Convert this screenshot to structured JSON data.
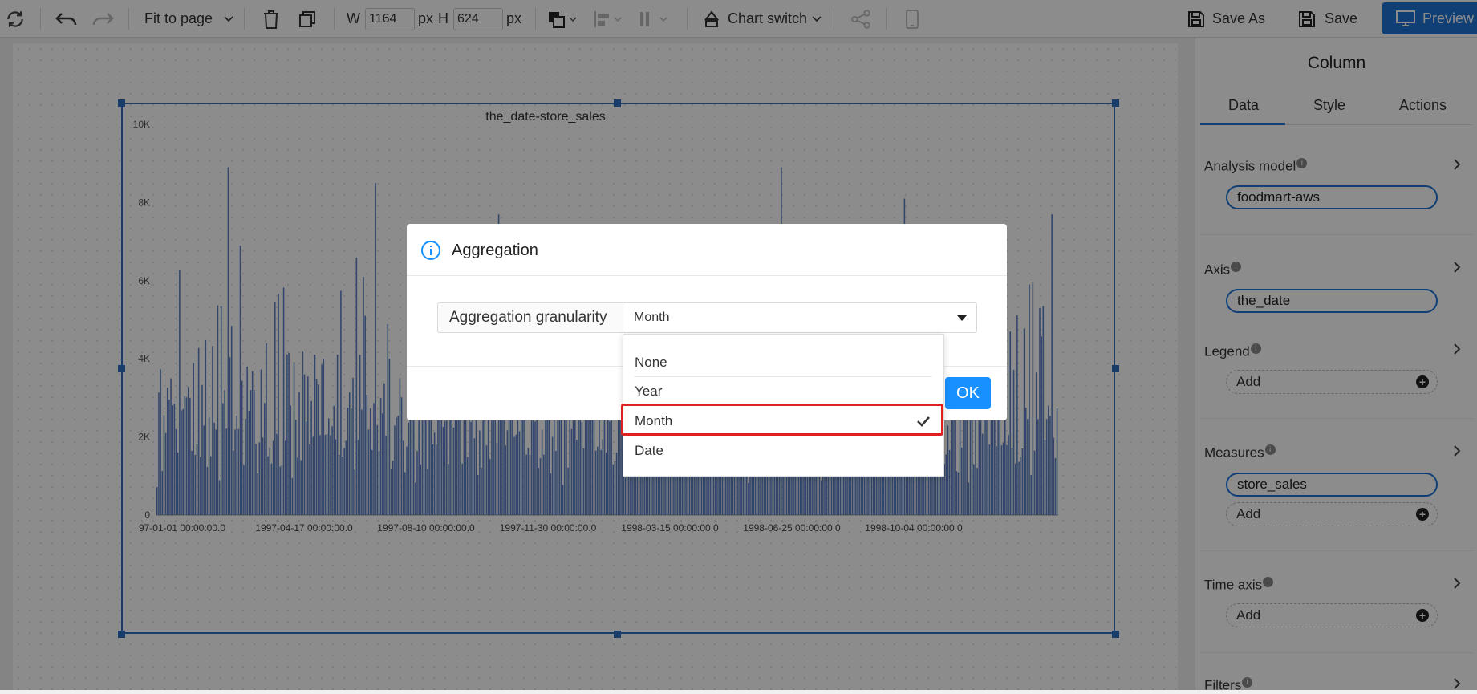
{
  "toolbar": {
    "fit_label": "Fit to page",
    "w_label": "W",
    "w_value": "1164",
    "px1": "px",
    "h_label": "H",
    "h_value": "624",
    "px2": "px",
    "chart_switch_label": "Chart switch",
    "save_as_label": "Save As",
    "save_label": "Save",
    "preview_label": "Preview"
  },
  "panel": {
    "title": "Column",
    "tabs": [
      "Data",
      "Style",
      "Actions"
    ],
    "analysis_model_label": "Analysis model",
    "analysis_model_value": "foodmart-aws",
    "axis_label": "Axis",
    "axis_value": "the_date",
    "legend_label": "Legend",
    "measures_label": "Measures",
    "measures_value": "store_sales",
    "time_axis_label": "Time axis",
    "filters_label": "Filters",
    "add_label": "Add",
    "info_glyph": "i"
  },
  "dialog": {
    "title": "Aggregation",
    "field_label": "Aggregation granularity",
    "selected_value": "Month",
    "ok_label": "OK",
    "options": [
      "None",
      "Year",
      "Month",
      "Date"
    ]
  },
  "chart_data": {
    "type": "bar",
    "title": "the_date-store_sales",
    "ylim": [
      0,
      10000
    ],
    "y_ticks": [
      "0",
      "2K",
      "4K",
      "6K",
      "8K",
      "10K"
    ],
    "x_tick_labels": [
      "97-01-01 00:00:00.0",
      "1997-04-17 00:00:00.0",
      "1997-08-10 00:00:00.0",
      "1997-11-30 00:00:00.0",
      "1998-03-15 00:00:00.0",
      "1998-06-25 00:00:00.0",
      "1998-10-04 00:00:00.0"
    ],
    "bar_color": "#5b7fc4",
    "approx_daily_values_sample": [
      1300,
      2200,
      2000,
      5600,
      1500,
      2800,
      3500,
      4300,
      2000,
      1800,
      3000,
      6900,
      2500,
      3200,
      4100,
      7100,
      2400,
      3800,
      3000,
      2200,
      4700,
      3300,
      1900,
      2600,
      3900,
      2800,
      5000,
      2500,
      4000,
      3300,
      6000,
      3100,
      3700,
      2700,
      4300,
      3000,
      2200,
      4800,
      3500,
      6700,
      8900,
      3000,
      2400,
      6900,
      5100,
      7300,
      4400,
      3600,
      5900,
      7000,
      4500,
      3600
    ]
  }
}
